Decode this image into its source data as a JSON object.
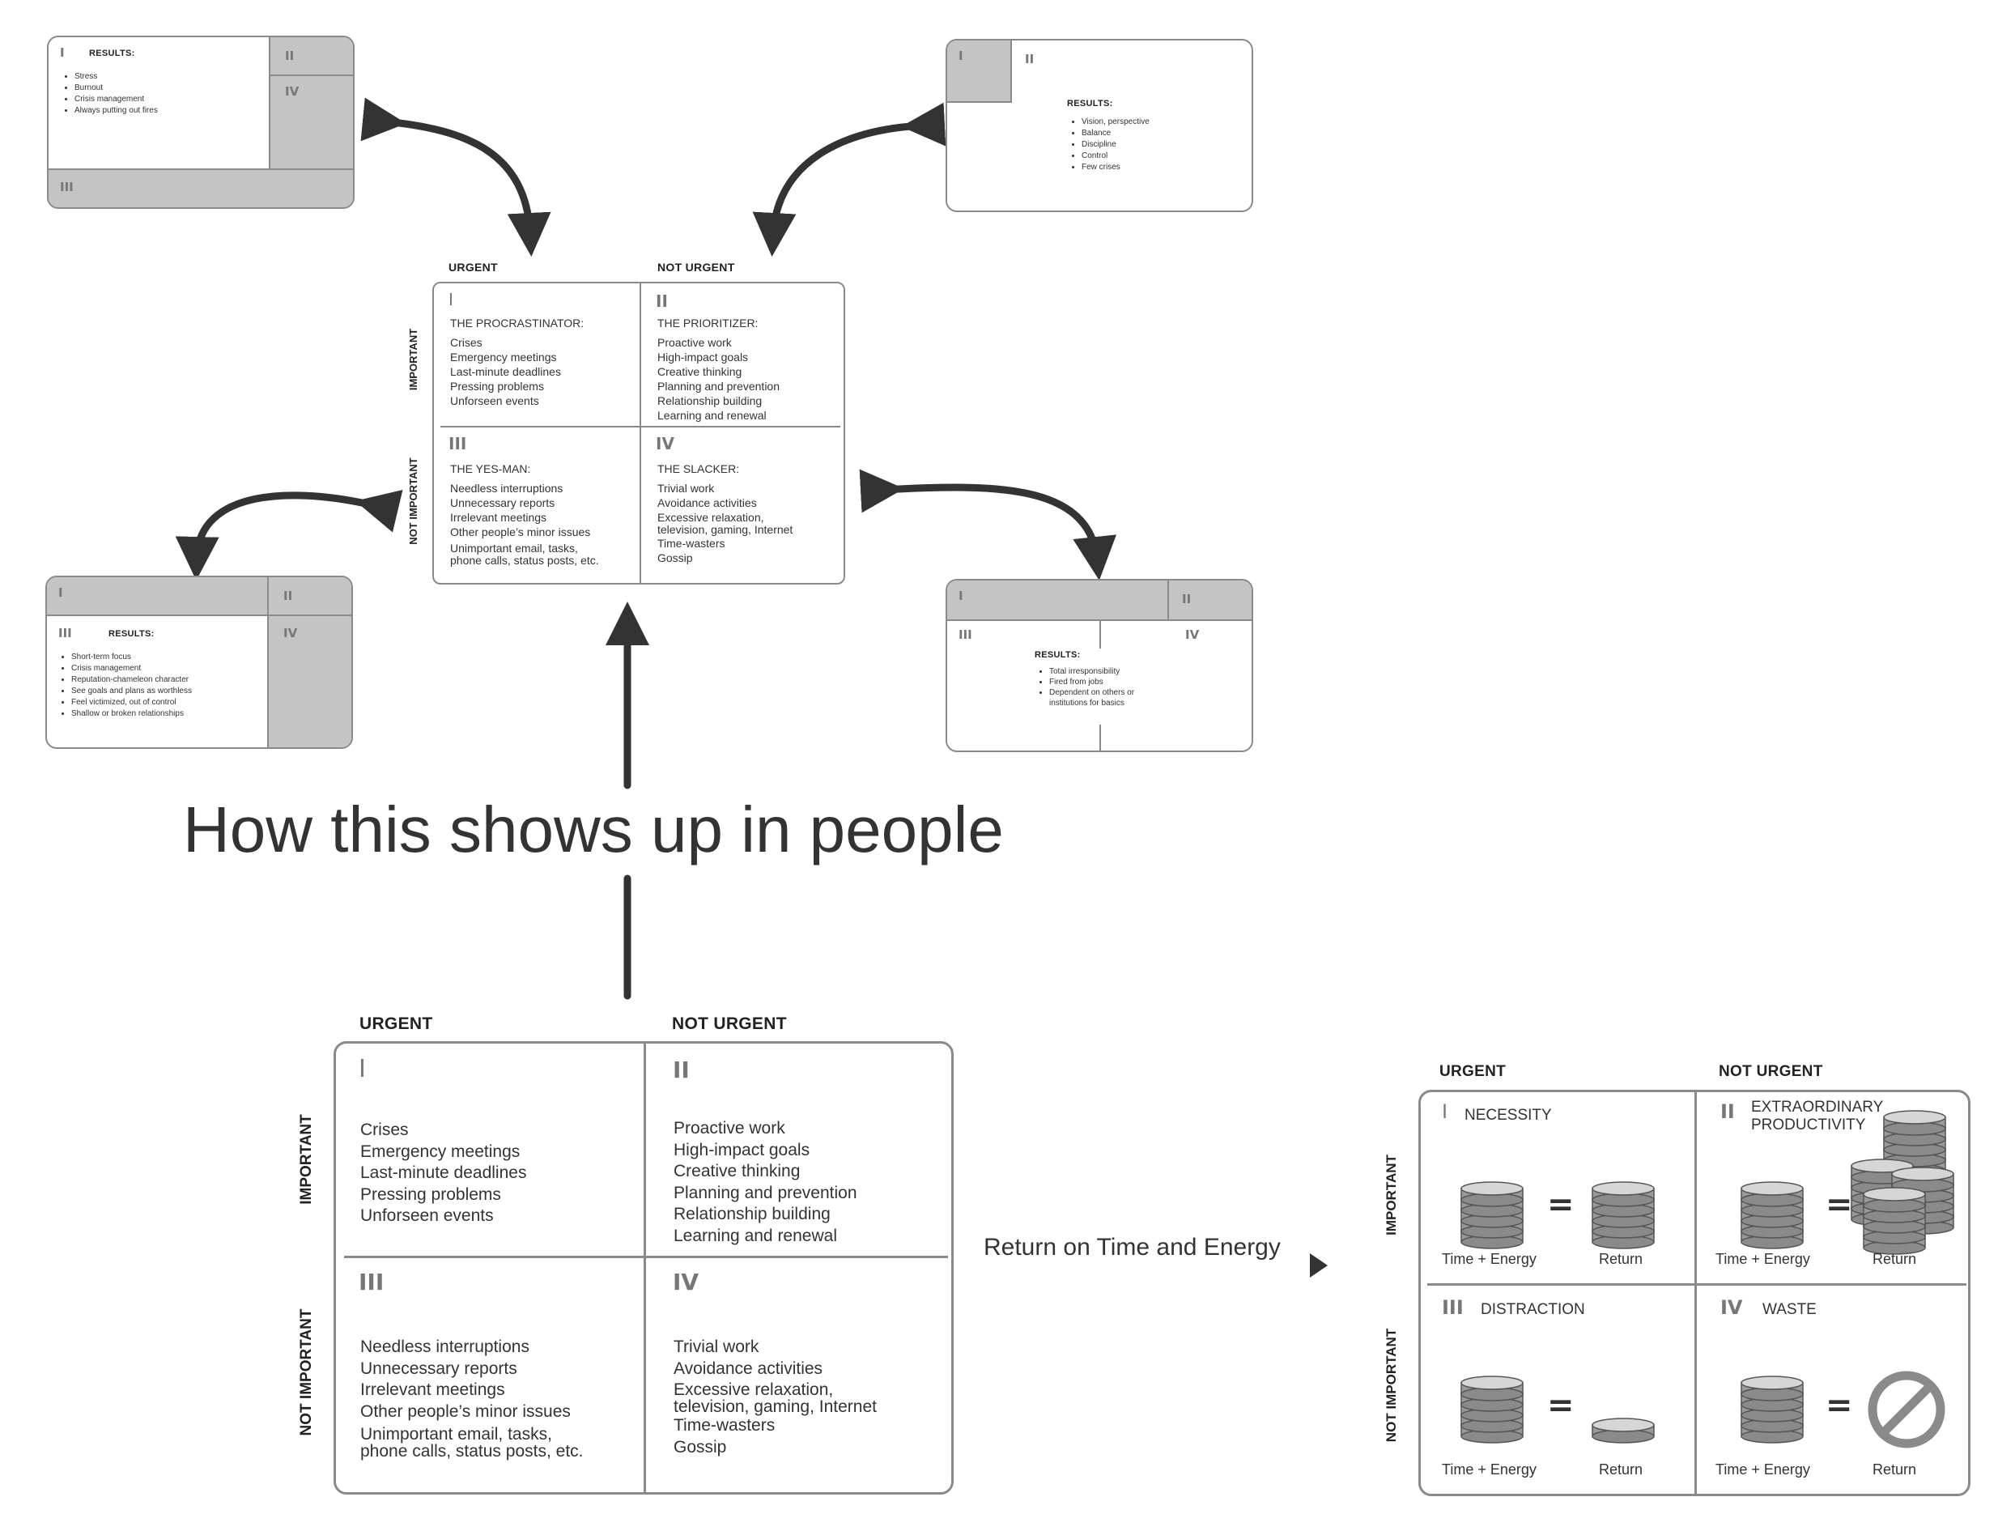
{
  "main_title": "How this shows up in people",
  "connector_label": "Return on Time and Energy",
  "column_headers": {
    "urgent": "URGENT",
    "not_urgent": "NOT URGENT"
  },
  "row_headers": {
    "important": "IMPORTANT",
    "not_important": "NOT IMPORTANT"
  },
  "numerals": [
    "I",
    "II",
    "III",
    "IV"
  ],
  "mini_results": {
    "label": "RESULTS:",
    "q1": [
      "Stress",
      "Burnout",
      "Crisis management",
      "Always putting out fires"
    ],
    "q2": [
      "Vision, perspective",
      "Balance",
      "Discipline",
      "Control",
      "Few crises"
    ],
    "q3": [
      "Short-term focus",
      "Crisis management",
      "Reputation-chameleon character",
      "See goals and plans as worthless",
      "Feel victimized, out of control",
      "Shallow or broken relationships"
    ],
    "q4": [
      "Total irresponsibility",
      "Fired from jobs",
      "Dependent on others or",
      "institutions for basics"
    ]
  },
  "people_matrix": {
    "q1_title": "THE PROCRASTINATOR:",
    "q2_title": "THE PRIORITIZER:",
    "q3_title": "THE YES-MAN:",
    "q4_title": "THE SLACKER:"
  },
  "matrix_items": {
    "q1": [
      "Crises",
      "Emergency meetings",
      "Last-minute deadlines",
      "Pressing problems",
      "Unforseen events"
    ],
    "q2": [
      "Proactive work",
      "High-impact goals",
      "Creative thinking",
      "Planning and prevention",
      "Relationship building",
      "Learning and renewal"
    ],
    "q3": [
      "Needless interruptions",
      "Unnecessary reports",
      "Irrelevant meetings",
      "Other people’s minor issues",
      "Unimportant email, tasks,",
      "phone calls, status posts, etc."
    ],
    "q4": [
      "Trivial work",
      "Avoidance activities",
      "Excessive relaxation,",
      "television, gaming, Internet",
      "Time-wasters",
      "Gossip"
    ]
  },
  "return_matrix": {
    "q1_title": "NECESSITY",
    "q2_title_1": "EXTRAORDINARY",
    "q2_title_2": "PRODUCTIVITY",
    "q3_title": "DISTRACTION",
    "q4_title": "WASTE",
    "input_label": "Time + Energy",
    "output_label": "Return",
    "equals": "="
  },
  "colors": {
    "arrow": "#333333",
    "shade": "#c4c4c4",
    "border": "#8a8a8a",
    "coin": "#9a9a9a"
  }
}
